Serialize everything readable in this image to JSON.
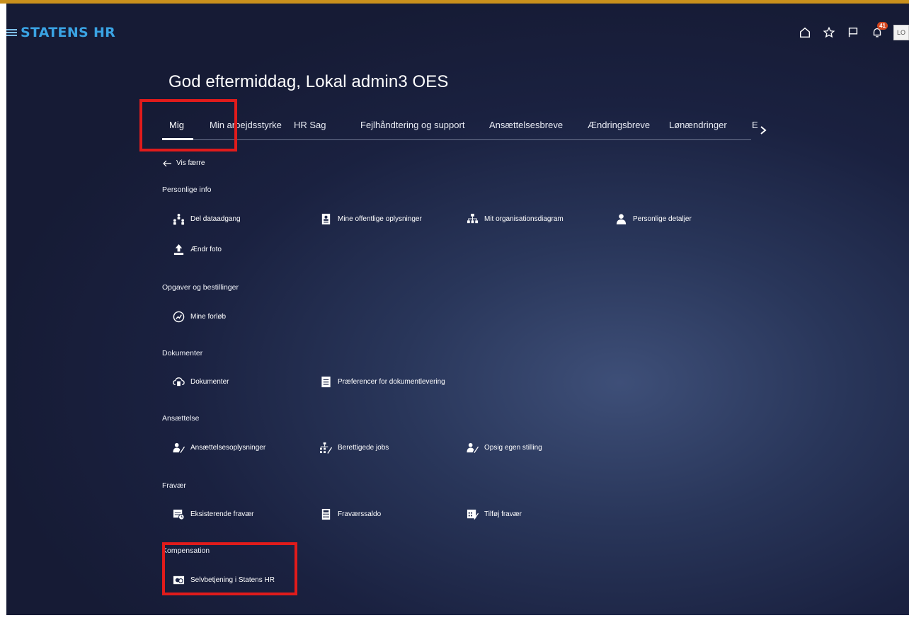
{
  "app": {
    "brand": "STATENS HR"
  },
  "header": {
    "notification_count": "41",
    "avatar_text": "LO"
  },
  "greeting": "God eftermiddag, Lokal admin3 OES",
  "tabs": [
    {
      "label": "Mig"
    },
    {
      "label": "Min arbejdsstyrke"
    },
    {
      "label": "HR Sag"
    },
    {
      "label": "Fejlhåndtering og support"
    },
    {
      "label": "Ansættelsesbreve"
    },
    {
      "label": "Ændringsbreve"
    },
    {
      "label": "Lønændringer"
    },
    {
      "label": "E"
    }
  ],
  "back_label": "Vis færre",
  "sections": {
    "personal": {
      "title": "Personlige info",
      "items": [
        "Del dataadgang",
        "Mine offentlige oplysninger",
        "Mit organisationsdiagram",
        "Personlige detaljer",
        "Ændr foto"
      ]
    },
    "tasks": {
      "title": "Opgaver og bestillinger",
      "items": [
        "Mine forløb"
      ]
    },
    "documents": {
      "title": "Dokumenter",
      "items": [
        "Dokumenter",
        "Præferencer for dokumentlevering"
      ]
    },
    "employment": {
      "title": "Ansættelse",
      "items": [
        "Ansættelsesoplysninger",
        "Berettigede jobs",
        "Opsig egen stilling"
      ]
    },
    "absence": {
      "title": "Fravær",
      "items": [
        "Eksisterende fravær",
        "Fraværssaldo",
        "Tilføj fravær"
      ]
    },
    "compensation": {
      "title": "Kompensation",
      "items": [
        "Selvbetjening i Statens HR"
      ]
    }
  },
  "colors": {
    "accent": "#3aa3e3",
    "highlight": "#e01b1b",
    "badge": "#d2451e",
    "top_stripe": "#c9901c"
  }
}
